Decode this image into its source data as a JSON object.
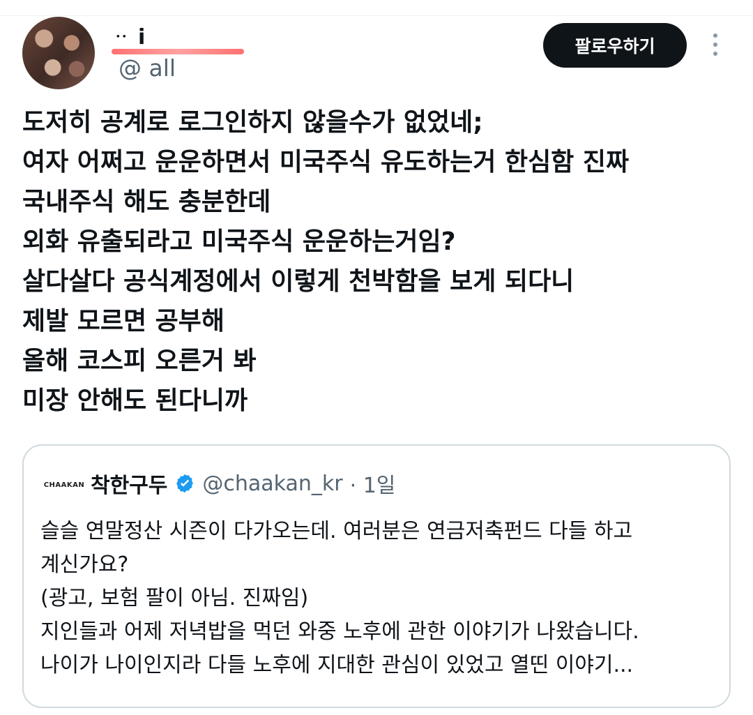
{
  "header": {
    "display_name": "ᆢ i",
    "handle": "@        all",
    "follow_button": "팔로우하기"
  },
  "tweet": {
    "lines": [
      "도저히 공계로 로그인하지 않을수가 없었네;",
      "여자 어쩌고 운운하면서 미국주식 유도하는거 한심함 진짜",
      "국내주식 해도 충분한데",
      "외화 유출되라고 미국주식 운운하는거임?",
      "살다살다 공식계정에서 이렇게 천박함을 보게 되다니",
      "제발 모르면 공부해",
      "올해 코스피 오른거 봐",
      "미장 안해도 된다니까"
    ]
  },
  "quote": {
    "avatar_text": "CHAAKAN",
    "name": "착한구두",
    "handle": "@chaakan_kr",
    "time": "· 1일",
    "lines": [
      "슬슬 연말정산 시즌이 다가오는데. 여러분은 연금저축펀드 다들 하고",
      "계신가요?",
      "(광고, 보험 팔이 아님. 진짜임)",
      "지인들과 어제 저녁밥을 먹던 와중 노후에 관한 이야기가 나왔습니다.",
      "나이가 나이인지라 다들 노후에 지대한 관심이 있었고 열띤 이야기..."
    ]
  },
  "icons": {
    "more": "more-vertical-icon",
    "verified": "verified-badge-icon"
  },
  "colors": {
    "text_primary": "#0f1419",
    "text_secondary": "#536471",
    "button_bg": "#0f1419",
    "button_text": "#ffffff",
    "verified_blue": "#1d9bf0",
    "border": "#cfd9de"
  }
}
